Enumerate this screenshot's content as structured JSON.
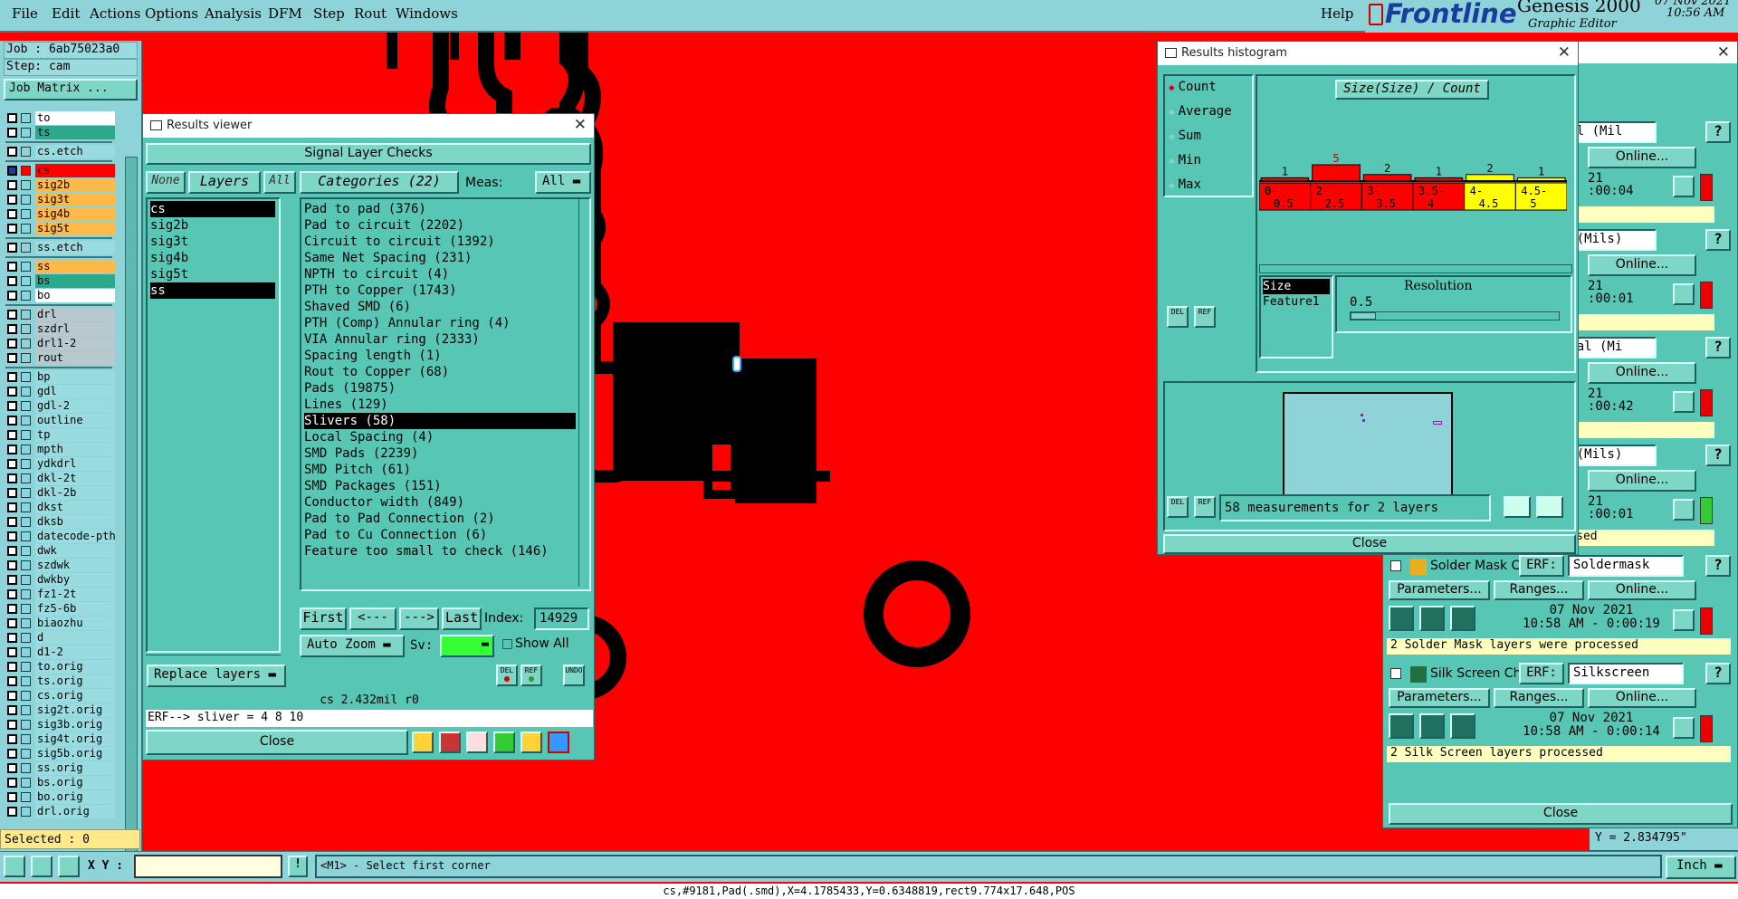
{
  "menu": {
    "items": [
      "File",
      "Edit",
      "Actions",
      "Options",
      "Analysis",
      "DFM",
      "Step",
      "Rout",
      "Windows"
    ],
    "help": "Help",
    "logo": "Frontline",
    "product": "Genesis 2000",
    "subtitle": "Graphic Editor",
    "date": "07 Nov 2021",
    "time": "10:56 AM"
  },
  "left": {
    "job": "Job : 6ab75023a0",
    "step": "Step: cam",
    "job_matrix": "Job Matrix ...",
    "selected": "Selected : 0",
    "layers": [
      {
        "name": "to",
        "color": "white"
      },
      {
        "name": "ts",
        "color": "green"
      },
      {
        "name": "cs.etch",
        "color": "plain"
      },
      {
        "name": "cs",
        "color": "red"
      },
      {
        "name": "sig2b",
        "color": "orange"
      },
      {
        "name": "sig3t",
        "color": "orange"
      },
      {
        "name": "sig4b",
        "color": "orange"
      },
      {
        "name": "sig5t",
        "color": "orange"
      },
      {
        "name": "ss.etch",
        "color": "plain"
      },
      {
        "name": "ss",
        "color": "orange"
      },
      {
        "name": "bs",
        "color": "green"
      },
      {
        "name": "bo",
        "color": "white"
      },
      {
        "name": "drl",
        "color": "gray"
      },
      {
        "name": "szdrl",
        "color": "gray"
      },
      {
        "name": "drl1-2",
        "color": "gray"
      },
      {
        "name": "rout",
        "color": "gray"
      },
      {
        "name": "bp",
        "color": "plain"
      },
      {
        "name": "gdl",
        "color": "plain"
      },
      {
        "name": "gdl-2",
        "color": "plain"
      },
      {
        "name": "outline",
        "color": "plain"
      },
      {
        "name": "tp",
        "color": "plain"
      },
      {
        "name": "mpth",
        "color": "plain"
      },
      {
        "name": "ydkdrl",
        "color": "plain"
      },
      {
        "name": "dkl-2t",
        "color": "plain"
      },
      {
        "name": "dkl-2b",
        "color": "plain"
      },
      {
        "name": "dkst",
        "color": "plain"
      },
      {
        "name": "dksb",
        "color": "plain"
      },
      {
        "name": "datecode-pth",
        "color": "plain"
      },
      {
        "name": "dwk",
        "color": "plain"
      },
      {
        "name": "szdwk",
        "color": "plain"
      },
      {
        "name": "dwkby",
        "color": "plain"
      },
      {
        "name": "fz1-2t",
        "color": "plain"
      },
      {
        "name": "fz5-6b",
        "color": "plain"
      },
      {
        "name": "biaozhu",
        "color": "plain"
      },
      {
        "name": "d",
        "color": "plain"
      },
      {
        "name": "d1-2",
        "color": "plain"
      },
      {
        "name": "to.orig",
        "color": "plain"
      },
      {
        "name": "ts.orig",
        "color": "plain"
      },
      {
        "name": "cs.orig",
        "color": "plain"
      },
      {
        "name": "sig2t.orig",
        "color": "plain"
      },
      {
        "name": "sig3b.orig",
        "color": "plain"
      },
      {
        "name": "sig4t.orig",
        "color": "plain"
      },
      {
        "name": "sig5b.orig",
        "color": "plain"
      },
      {
        "name": "ss.orig",
        "color": "plain"
      },
      {
        "name": "bs.orig",
        "color": "plain"
      },
      {
        "name": "bo.orig",
        "color": "plain"
      },
      {
        "name": "drl.orig",
        "color": "plain"
      }
    ]
  },
  "viewer": {
    "title": "Results viewer",
    "header": "Signal Layer Checks",
    "none": "None",
    "layers_label": "Layers",
    "all": "All",
    "categories": "Categories (22)",
    "meas_label": "Meas:",
    "meas_value": "All",
    "layer_list": [
      "cs",
      "sig2b",
      "sig3t",
      "sig4b",
      "sig5t",
      "ss"
    ],
    "cat_list": [
      "Pad to pad (376)",
      "Pad to circuit (2202)",
      "Circuit to circuit (1392)",
      "Same Net Spacing (231)",
      "NPTH to circuit (4)",
      "PTH to Copper (1743)",
      "Shaved SMD (6)",
      "PTH (Comp) Annular ring (4)",
      "VIA Annular ring (2333)",
      "Spacing length (1)",
      "Rout to Copper (68)",
      "Pads (19875)",
      "Lines (129)",
      "Slivers (58)",
      "Local Spacing (4)",
      "SMD Pads (2239)",
      "SMD Pitch (61)",
      "SMD Packages (151)",
      "Conductor width (849)",
      "Pad to Pad Connection (2)",
      "Pad to Cu Connection (6)",
      "Feature too small to check (146)"
    ],
    "first": "First",
    "prev": "<---",
    "next": "--->",
    "last": "Last",
    "index_label": "Index:",
    "index_value": "14929",
    "auto_zoom": "Auto Zoom",
    "sv": "Sv:",
    "show_all": "Show All",
    "replace_layers": "Replace layers",
    "del": "DEL",
    "ref": "REF",
    "undo": "UNDO",
    "info": "cs 2.432mil  r0",
    "erf": "ERF--> sliver = 4 8 10",
    "close": "Close"
  },
  "histogram": {
    "title": "Results histogram",
    "options": [
      "Count",
      "Average",
      "Sum",
      "Min",
      "Max"
    ],
    "chart_title": "Size(Size) / Count",
    "resolution_label": "Resolution",
    "resolution_value": "0.5",
    "fields": [
      "Size",
      "Feature1"
    ],
    "del": "DEL",
    "ref": "REF",
    "summary": "58 measurements for 2 layers",
    "close": "Close"
  },
  "chart_data": {
    "type": "bar",
    "title": "Size(Size) / Count",
    "categories": [
      "0-0.5",
      "2-2.5",
      "3-3.5",
      "3.5-4",
      "4-4.5",
      "4.5-5"
    ],
    "values": [
      1,
      5,
      2,
      1,
      2,
      1
    ],
    "colors": [
      "#ff0000",
      "#ff0000",
      "#ff0000",
      "#ff0000",
      "#ffff00",
      "#ffff00"
    ]
  },
  "checklist": {
    "items": [
      {
        "desc": "Drill (Mil",
        "date": "21",
        "time": ":00:04",
        "note": ""
      },
      {
        "desc": "Std (Mils)",
        "date": "21",
        "time": ":00:01",
        "note": ""
      },
      {
        "desc": "signal (Mi",
        "date": "21",
        "time": ":00:42",
        "note": ""
      },
      {
        "desc": "P/G (Mils)",
        "date": "21",
        "time": ":00:01",
        "note": "rocessed"
      }
    ],
    "online": "Online...",
    "parameters": "Parameters...",
    "ranges": "Ranges...",
    "erf": "ERF:",
    "solder_name": "Solder Mask Che",
    "solder_erf": "Soldermask",
    "solder_date": "07 Nov 2021",
    "solder_time": "10:58 AM - 0:00:19",
    "solder_note": "2 Solder Mask layers were processed",
    "silk_name": "Silk Screen Che",
    "silk_erf": "Silkscreen",
    "silk_date": "07 Nov 2021",
    "silk_time": "10:58 AM - 0:00:14",
    "silk_note": "2 Silk Screen layers processed",
    "close": "Close",
    "help": "?"
  },
  "bottom": {
    "xy_label": "X Y :",
    "xy_value": "",
    "prompt": "<M1> - Select first corner",
    "units": "Inch",
    "ycoord": "Y = 2.834795\"",
    "status": "cs,#9181,Pad(.smd),X=4.1785433,Y=0.6348819,rect9.774x17.648,POS"
  }
}
